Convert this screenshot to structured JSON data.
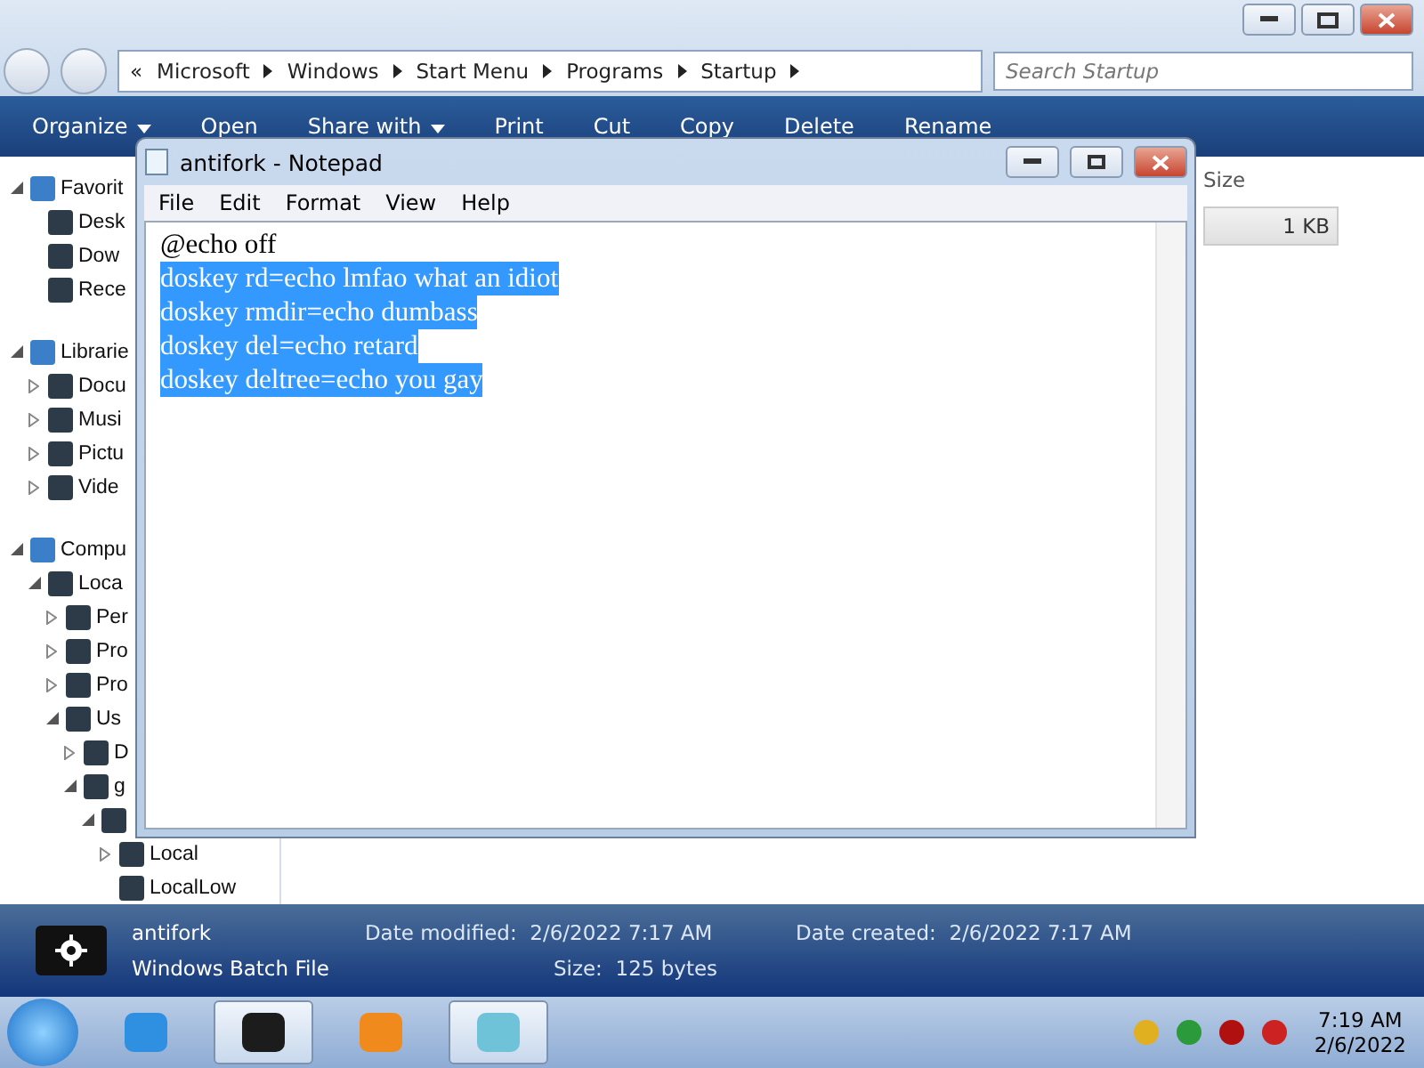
{
  "explorer": {
    "address": {
      "overflow": "«",
      "crumbs": [
        "Microsoft",
        "Windows",
        "Start Menu",
        "Programs",
        "Startup"
      ]
    },
    "search": {
      "placeholder": "Search Startup"
    },
    "toolbar": [
      {
        "label": "Organize",
        "dropdown": true
      },
      {
        "label": "Open",
        "dropdown": false
      },
      {
        "label": "Share with",
        "dropdown": true
      },
      {
        "label": "Print",
        "dropdown": false
      },
      {
        "label": "Cut",
        "dropdown": false
      },
      {
        "label": "Copy",
        "dropdown": false
      },
      {
        "label": "Delete",
        "dropdown": false
      },
      {
        "label": "Rename",
        "dropdown": false
      }
    ],
    "nav_tree": [
      {
        "label": "Favorit",
        "expanded": true,
        "children": [
          {
            "label": "Desk"
          },
          {
            "label": "Dow"
          },
          {
            "label": "Rece"
          }
        ]
      },
      {
        "label": "Librarie",
        "expanded": true,
        "children": [
          {
            "label": "Docu",
            "expanded": false
          },
          {
            "label": "Musi",
            "expanded": false
          },
          {
            "label": "Pictu",
            "expanded": false
          },
          {
            "label": "Vide",
            "expanded": false
          }
        ]
      },
      {
        "label": "Compu",
        "expanded": true,
        "children": [
          {
            "label": "Loca",
            "expanded": true,
            "children": [
              {
                "label": "Per",
                "expanded": false
              },
              {
                "label": "Pro",
                "expanded": false
              },
              {
                "label": "Pro",
                "expanded": false
              },
              {
                "label": "Us",
                "expanded": true,
                "children": [
                  {
                    "label": "D",
                    "expanded": false
                  },
                  {
                    "label": "g",
                    "expanded": true,
                    "children": [
                      {
                        "expanded": true,
                        "children": [
                          {
                            "label": "Local",
                            "expanded": false
                          },
                          {
                            "label": "LocalLow"
                          }
                        ]
                      }
                    ]
                  }
                ]
              }
            ]
          }
        ]
      }
    ],
    "file_list": {
      "columns": [
        "Size"
      ],
      "rows": [
        {
          "size": "1 KB",
          "selected": true
        }
      ]
    },
    "details": {
      "name": "antifork",
      "type": "Windows Batch File",
      "fields": [
        {
          "label": "Date modified:",
          "value": "2/6/2022 7:17 AM"
        },
        {
          "label": "Date created:",
          "value": "2/6/2022 7:17 AM"
        },
        {
          "label": "Size:",
          "value": "125 bytes"
        }
      ]
    }
  },
  "notepad": {
    "title": "antifork - Notepad",
    "menu": [
      "File",
      "Edit",
      "Format",
      "View",
      "Help"
    ],
    "lines": [
      {
        "text": "@echo off",
        "selected": false
      },
      {
        "text": "doskey rd=echo lmfao what an idiot",
        "selected": true
      },
      {
        "text": "doskey rmdir=echo dumbass",
        "selected": true
      },
      {
        "text": "doskey del=echo retard",
        "selected": true
      },
      {
        "text": "doskey deltree=echo you gay",
        "selected": true
      }
    ]
  },
  "taskbar": {
    "apps": [
      {
        "kind": "ie",
        "active": false
      },
      {
        "kind": "terminal",
        "active": true
      },
      {
        "kind": "media",
        "active": false
      },
      {
        "kind": "notepad",
        "active": true
      }
    ],
    "time": "7:19 AM",
    "date": "2/6/2022"
  }
}
